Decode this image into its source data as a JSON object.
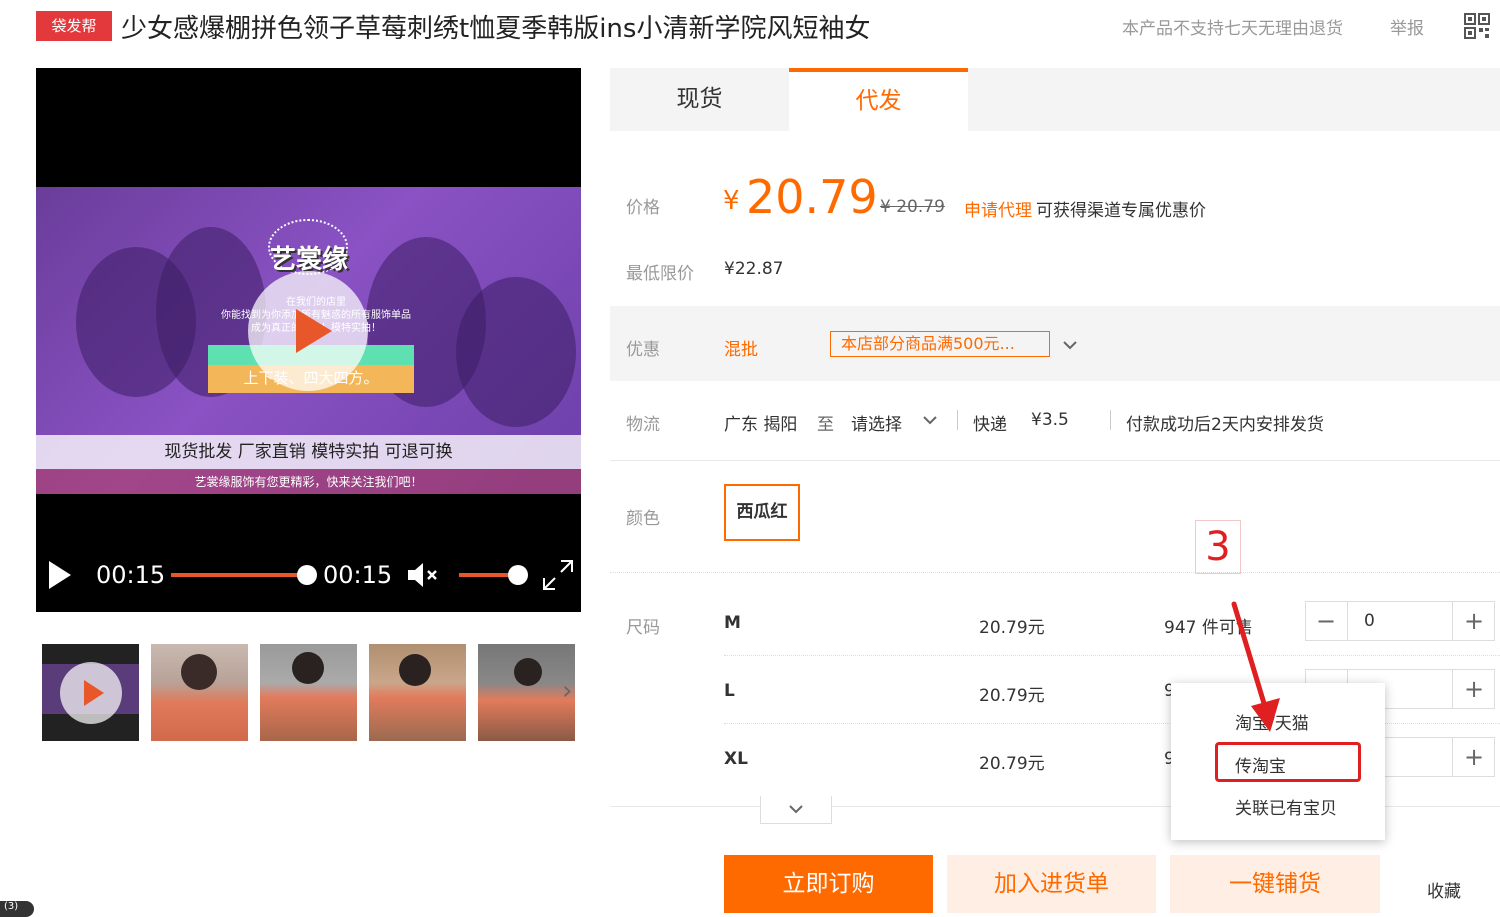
{
  "header": {
    "badge": "袋发帮",
    "title": "少女感爆棚拼色领子草莓刺绣t恤夏季韩版ins小清新学院风短袖女",
    "return_note": "本产品不支持七天无理由退货",
    "report": "举报",
    "qr_icon": "qr-code-icon"
  },
  "video": {
    "brand": "艺裳缘",
    "line1": "在我们的店里",
    "line2": "你能找到为你添加所有魅惑的所有服饰单品",
    "line3": "成为真正的自己！模特实拍！",
    "ribbon": "上下装、四大四方。",
    "banner": "现货批发 厂家直销 模特实拍 可退可换",
    "banner_sub": "艺裳缘服饰有您更精彩，快来关注我们吧！",
    "current_time": "00:15",
    "duration": "00:15",
    "progress": 1.0,
    "volume": 1.0
  },
  "tabs": [
    {
      "label": "现货",
      "active": false
    },
    {
      "label": "代发",
      "active": true
    }
  ],
  "price": {
    "label": "价格",
    "currency": "¥",
    "value": "20.79",
    "original": "¥ 20.79",
    "agent_link": "申请代理",
    "agent_text": "可获得渠道专属优惠价"
  },
  "min_price": {
    "label": "最低限价",
    "value": "¥22.87"
  },
  "promo": {
    "label": "优惠",
    "type": "混批",
    "tag": "本店部分商品满500元..."
  },
  "logistics": {
    "label": "物流",
    "origin": "广东 揭阳",
    "to": "至",
    "dest": "请选择",
    "method": "快递",
    "fee": "¥3.5",
    "note": "付款成功后2天内安排发货"
  },
  "color": {
    "label": "颜色",
    "selected": "西瓜红"
  },
  "size": {
    "label": "尺码",
    "rows": [
      {
        "name": "M",
        "price": "20.79元",
        "stock": "947 件可售",
        "qty": "0"
      },
      {
        "name": "L",
        "price": "20.79元",
        "stock": "9",
        "qty": ""
      },
      {
        "name": "XL",
        "price": "20.79元",
        "stock": "9",
        "qty": ""
      }
    ]
  },
  "popup": {
    "items": [
      "淘宝/天猫",
      "传淘宝",
      "关联已有宝贝"
    ]
  },
  "annotation": {
    "step": "3"
  },
  "buttons": {
    "buy": "立即订购",
    "cart": "加入进货单",
    "one_click": "一键铺货",
    "favorite": "收藏"
  },
  "corner_label": "(3)",
  "colors": {
    "accent": "#ff6a00",
    "badge": "#e4393c",
    "annotation": "#e02020"
  }
}
